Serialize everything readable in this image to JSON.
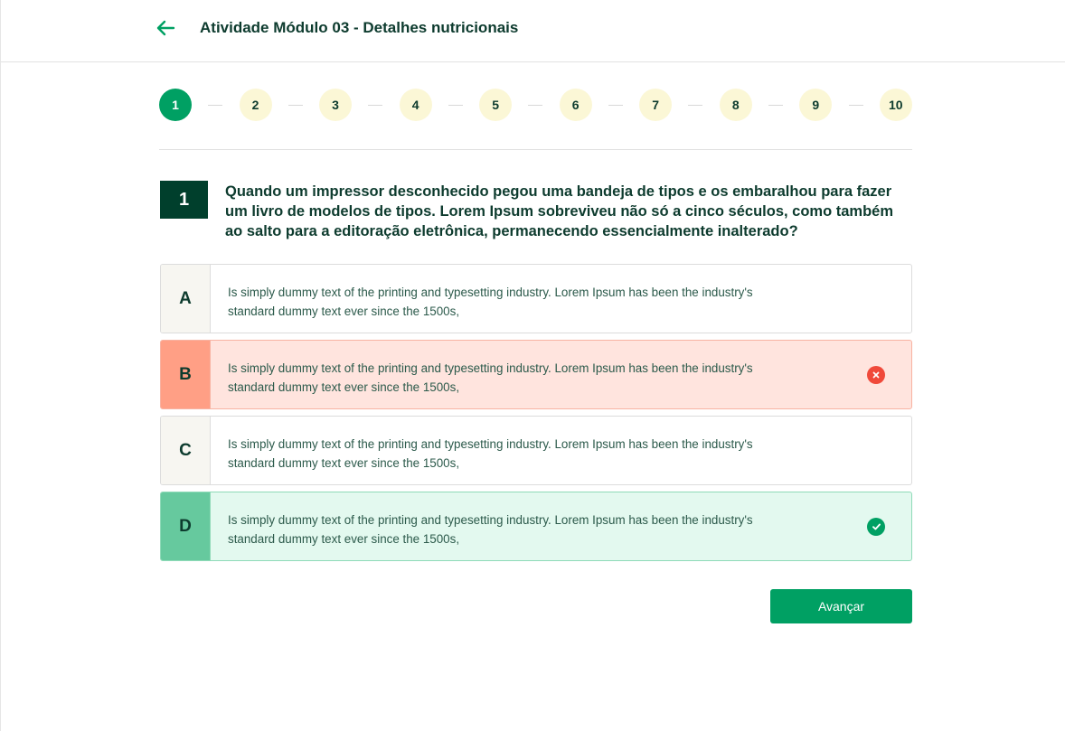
{
  "header": {
    "back_icon": "arrow-left-icon",
    "title": "Atividade Módulo 03 - Detalhes nutricionais"
  },
  "steps": {
    "current": 1,
    "items": [
      "1",
      "2",
      "3",
      "4",
      "5",
      "6",
      "7",
      "8",
      "9",
      "10"
    ]
  },
  "question": {
    "number": "1",
    "text": "Quando um impressor desconhecido pegou uma bandeja de tipos e os embaralhou para fazer um livro de modelos de tipos. Lorem Ipsum sobreviveu não só a cinco séculos, como também ao salto para a editoração eletrônica, permanecendo essencialmente inalterado?"
  },
  "options": [
    {
      "letter": "A",
      "text": "Is simply dummy text of the printing and typesetting industry. Lorem Ipsum has been the industry's standard dummy text ever since the 1500s,",
      "state": "neutral"
    },
    {
      "letter": "B",
      "text": "Is simply dummy text of the printing and typesetting industry. Lorem Ipsum has been the industry's standard dummy text ever since the 1500s,",
      "state": "wrong",
      "icon": "close-circle-icon"
    },
    {
      "letter": "C",
      "text": "Is simply dummy text of the printing and typesetting industry. Lorem Ipsum has been the industry's standard dummy text ever since the 1500s,",
      "state": "neutral"
    },
    {
      "letter": "D",
      "text": "Is simply dummy text of the printing and typesetting industry. Lorem Ipsum has been the industry's standard dummy text ever since the 1500s,",
      "state": "correct",
      "icon": "check-circle-icon"
    }
  ],
  "actions": {
    "advance_label": "Avançar"
  },
  "colors": {
    "primary": "#00a063",
    "dark_green": "#003f2c",
    "step_bg": "#fbf7d6",
    "wrong_bg": "#ffe4de",
    "wrong_letter": "#ff9f85",
    "wrong_icon": "#f0493a",
    "correct_bg": "#e3f9ef",
    "correct_letter": "#66c99e"
  }
}
